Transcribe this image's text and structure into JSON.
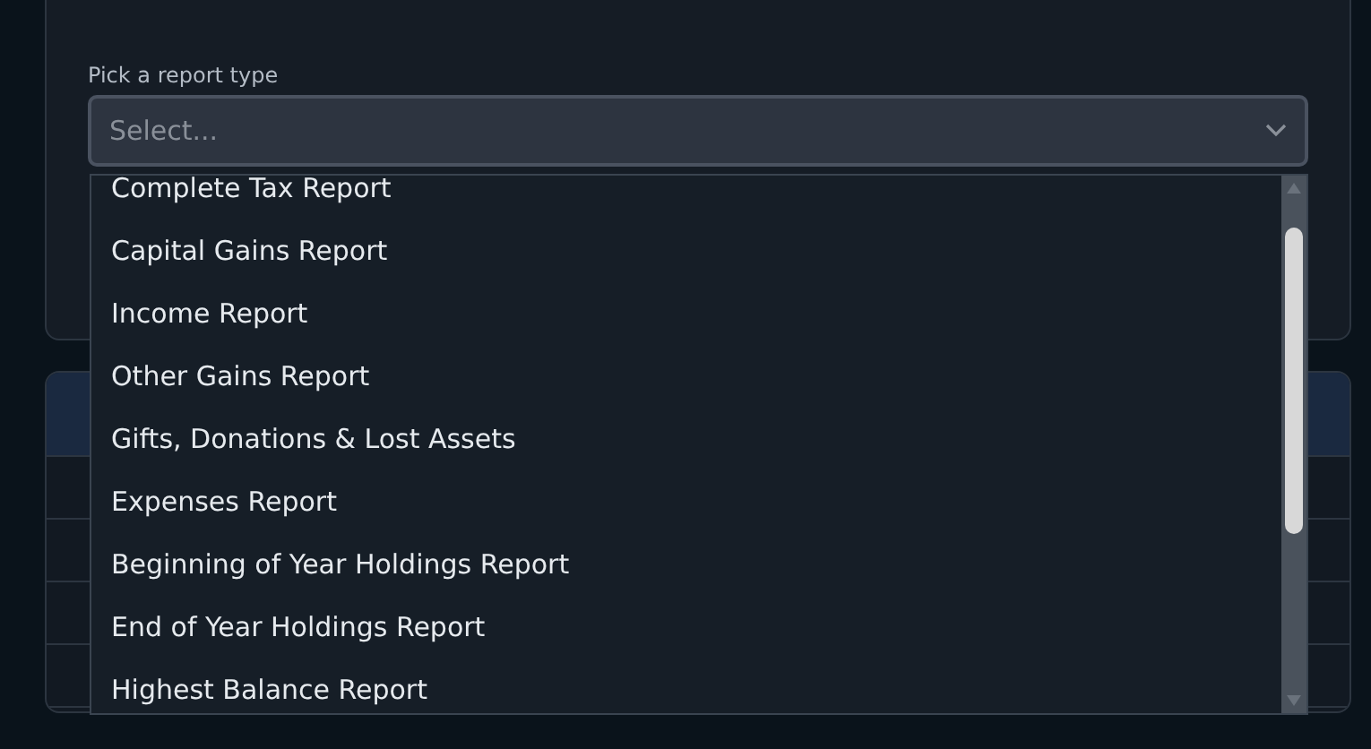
{
  "report_form": {
    "label": "Pick a report type",
    "select": {
      "placeholder": "Select..."
    },
    "dropdown": {
      "options": [
        {
          "label": "Complete Tax Report",
          "selected": false
        },
        {
          "label": "Capital Gains Report",
          "selected": false
        },
        {
          "label": "Income Report",
          "selected": false
        },
        {
          "label": "Other Gains Report",
          "selected": false
        },
        {
          "label": "Gifts, Donations & Lost Assets",
          "selected": false
        },
        {
          "label": "Expenses Report",
          "selected": false
        },
        {
          "label": "Beginning of Year Holdings Report",
          "selected": false
        },
        {
          "label": "End of Year Holdings Report",
          "selected": false
        },
        {
          "label": "Highest Balance Report",
          "selected": false
        }
      ]
    }
  }
}
